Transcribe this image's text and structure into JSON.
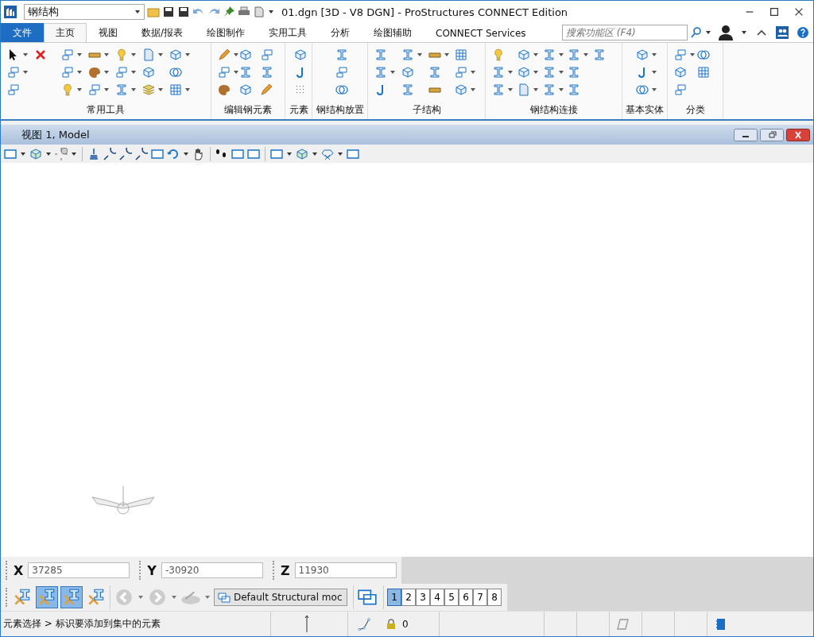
{
  "window": {
    "workflow": "钢结构",
    "title": "01.dgn [3D - V8 DGN] - ProStructures CONNECT Edition"
  },
  "tabs": [
    {
      "label": "文件",
      "kind": "file",
      "selected": false
    },
    {
      "label": "主页",
      "kind": "tab",
      "selected": true
    },
    {
      "label": "视图",
      "kind": "tab",
      "selected": false
    },
    {
      "label": "数据/报表",
      "kind": "tab",
      "selected": false
    },
    {
      "label": "绘图制作",
      "kind": "tab",
      "selected": false
    },
    {
      "label": "实用工具",
      "kind": "tab",
      "selected": false
    },
    {
      "label": "分析",
      "kind": "tab",
      "selected": false
    },
    {
      "label": "绘图辅助",
      "kind": "tab",
      "selected": false
    },
    {
      "label": "CONNECT Services",
      "kind": "tab",
      "selected": false
    }
  ],
  "search": {
    "placeholder": "搜索功能区 (F4)"
  },
  "ribbon_groups": [
    {
      "label": "常用工具"
    },
    {
      "label": "编辑钢元素"
    },
    {
      "label": "元素"
    },
    {
      "label": "钢结构放置"
    },
    {
      "label": "子结构"
    },
    {
      "label": "钢结构连接"
    },
    {
      "label": "基本实体"
    },
    {
      "label": "分类"
    }
  ],
  "view": {
    "title": "视图 1, Model"
  },
  "coordinates": [
    {
      "axis": "X",
      "value": "37285"
    },
    {
      "axis": "Y",
      "value": "-30920"
    },
    {
      "axis": "Z",
      "value": "11930"
    }
  ],
  "tool_toggles": [
    {
      "selected": false
    },
    {
      "selected": true
    },
    {
      "selected": true
    },
    {
      "selected": false
    }
  ],
  "model_dropdown": {
    "value": "Default Structural moc"
  },
  "view_buttons": [
    {
      "label": "1",
      "selected": true
    },
    {
      "label": "2",
      "selected": false
    },
    {
      "label": "3",
      "selected": false
    },
    {
      "label": "4",
      "selected": false
    },
    {
      "label": "5",
      "selected": false
    },
    {
      "label": "6",
      "selected": false
    },
    {
      "label": "7",
      "selected": false
    },
    {
      "label": "8",
      "selected": false
    }
  ],
  "status_bar": {
    "prompt": "元素选择 > 标识要添加到集中的元素",
    "count": "0"
  }
}
